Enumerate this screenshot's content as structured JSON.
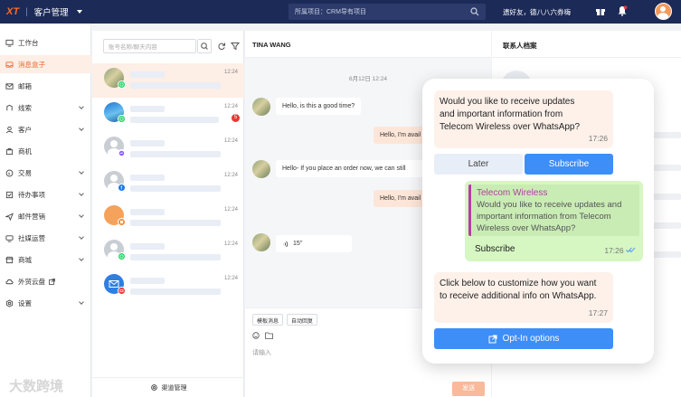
{
  "topbar": {
    "logo": "XT",
    "app_title": "客户管理",
    "project_search": "所属项目：CRM导有项目",
    "greeting": "遗好友，德八八六券嗨",
    "icons": [
      "gift-icon",
      "bell-icon",
      "help-icon"
    ]
  },
  "sidebar": {
    "items": [
      {
        "label": "工作台",
        "icon": "monitor-icon",
        "chevron": false,
        "active": false
      },
      {
        "label": "消息盒子",
        "icon": "inbox-icon",
        "chevron": false,
        "active": true
      },
      {
        "label": "邮箱",
        "icon": "mail-icon",
        "chevron": false,
        "active": false
      },
      {
        "label": "线索",
        "icon": "leads-icon",
        "chevron": true,
        "active": false
      },
      {
        "label": "客户",
        "icon": "customer-icon",
        "chevron": true,
        "active": false
      },
      {
        "label": "商机",
        "icon": "opportunity-icon",
        "chevron": false,
        "active": false
      },
      {
        "label": "交易",
        "icon": "deal-icon",
        "chevron": true,
        "active": false
      },
      {
        "label": "待办事项",
        "icon": "todo-icon",
        "chevron": true,
        "active": false
      },
      {
        "label": "邮件营销",
        "icon": "email-marketing-icon",
        "chevron": true,
        "active": false
      },
      {
        "label": "社媒运营",
        "icon": "social-icon",
        "chevron": true,
        "active": false
      },
      {
        "label": "商城",
        "icon": "store-icon",
        "chevron": true,
        "active": false
      },
      {
        "label": "外贸云盘",
        "icon": "cloud-drive-icon",
        "chevron": false,
        "active": false
      },
      {
        "label": "设置",
        "icon": "settings-icon",
        "chevron": true,
        "active": false
      }
    ]
  },
  "convlist": {
    "search_placeholder": "账号名称/聊天内容",
    "footer_label": "渠道管理",
    "rows": [
      {
        "time": "12:24",
        "avatar": "photo",
        "channel": "whatsapp",
        "unread": ""
      },
      {
        "time": "12:24",
        "avatar": "blue",
        "channel": "whatsapp",
        "unread": "5"
      },
      {
        "time": "12:24",
        "avatar": "person",
        "channel": "messenger",
        "unread": ""
      },
      {
        "time": "12:24",
        "avatar": "person",
        "channel": "facebook",
        "unread": ""
      },
      {
        "time": "12:24",
        "avatar": "orange",
        "channel": "orange",
        "unread": ""
      },
      {
        "time": "12:24",
        "avatar": "person",
        "channel": "whatsapp",
        "unread": ""
      },
      {
        "time": "12:24",
        "avatar": "blue2",
        "channel": "red",
        "unread": ""
      }
    ]
  },
  "chat": {
    "contact_name": "TINA WANG",
    "date": "6月12日 12:24",
    "messages": [
      {
        "dir": "in",
        "text": "Hello, is this a good time?"
      },
      {
        "dir": "out",
        "text": "Hello, I'm avail"
      },
      {
        "dir": "in",
        "text": "Hello- If you place an order now, we can still"
      },
      {
        "dir": "out",
        "text": "Hello, I'm avail"
      },
      {
        "dir": "in",
        "text": "15''"
      }
    ],
    "tools": [
      "模板消息",
      "自动回复"
    ],
    "input_placeholder": "请输入",
    "send_label": "发送"
  },
  "contact": {
    "title": "联系人档案"
  },
  "card": {
    "msg1_text": "Would you like to receive updates and important information from Telecom Wireless over WhatsApp?",
    "msg1_time": "17:26",
    "later_label": "Later",
    "subscribe_label": "Subscribe",
    "reply_quote_title": "Telecom Wireless",
    "reply_quote_text": "Would you like to receive updates and important information from Telecom Wireless over WhatsApp?",
    "reply_text": "Subscribe",
    "reply_time": "17:26",
    "msg2_text": "Click below to customize how you want to receive additional info on WhatsApp.",
    "msg2_time": "17:27",
    "optin_label": "Opt-In options"
  },
  "watermark": "大数跨境",
  "colors": {
    "accent": "#f16b2c",
    "topbar": "#1c2a57",
    "whatsapp": "#25d366",
    "messenger": "#8b5cf6",
    "facebook": "#1877f2",
    "button_blue": "#3e8ef7",
    "read_check": "#3e8ef7"
  }
}
